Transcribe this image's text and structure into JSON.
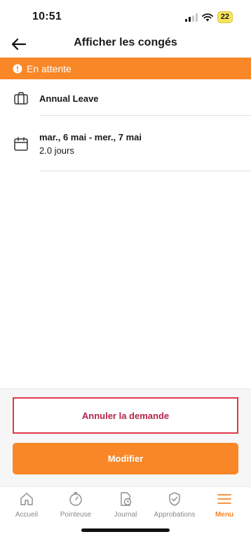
{
  "status_bar": {
    "time": "10:51",
    "battery": "22"
  },
  "header": {
    "title": "Afficher les congés"
  },
  "banner": {
    "status": "En attente",
    "color": "#f98728"
  },
  "leave": {
    "type": "Annual Leave",
    "date_range": "mar., 6 mai - mer., 7 mai",
    "duration": "2.0 jours"
  },
  "actions": {
    "cancel_label": "Annuler la demande",
    "modify_label": "Modifier"
  },
  "tabs": [
    {
      "label": "Accueil",
      "icon": "home-icon"
    },
    {
      "label": "Pointeuse",
      "icon": "stopwatch-icon"
    },
    {
      "label": "Journal",
      "icon": "journal-icon"
    },
    {
      "label": "Approbations",
      "icon": "shield-check-icon"
    },
    {
      "label": "Menu",
      "icon": "menu-icon",
      "active": true
    }
  ],
  "colors": {
    "accent": "#f98728",
    "danger": "#e0394a"
  }
}
